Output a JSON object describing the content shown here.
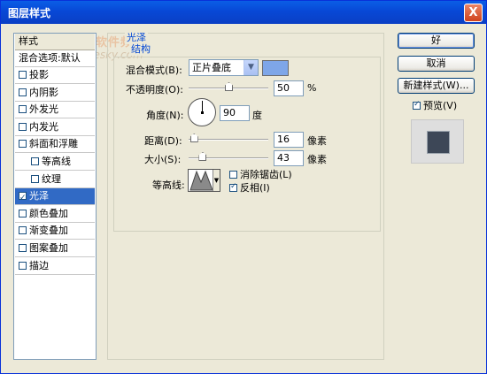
{
  "window": {
    "title": "图层样式",
    "close_label": "X"
  },
  "styles_list": {
    "header": "样式",
    "blend_default": "混合选项:默认",
    "items": [
      {
        "label": "投影",
        "checked": false,
        "indent": 0
      },
      {
        "label": "内阴影",
        "checked": false,
        "indent": 0
      },
      {
        "label": "外发光",
        "checked": false,
        "indent": 0
      },
      {
        "label": "内发光",
        "checked": false,
        "indent": 0
      },
      {
        "label": "斜面和浮雕",
        "checked": false,
        "indent": 0
      },
      {
        "label": "等高线",
        "checked": false,
        "indent": 1
      },
      {
        "label": "纹理",
        "checked": false,
        "indent": 1
      },
      {
        "label": "光泽",
        "checked": true,
        "indent": 0,
        "selected": true
      },
      {
        "label": "颜色叠加",
        "checked": false,
        "indent": 0
      },
      {
        "label": "渐变叠加",
        "checked": false,
        "indent": 0
      },
      {
        "label": "图案叠加",
        "checked": false,
        "indent": 0
      },
      {
        "label": "描边",
        "checked": false,
        "indent": 0
      }
    ]
  },
  "panel": {
    "section_title": "光泽",
    "group_title": "结构",
    "blend_mode_label": "混合模式(B):",
    "blend_mode_value": "正片叠底",
    "blend_color": "#7ea6e8",
    "opacity_label": "不透明度(O):",
    "opacity_value": "50",
    "opacity_unit": "%",
    "angle_label": "角度(N):",
    "angle_value": "90",
    "angle_unit": "度",
    "distance_label": "距离(D):",
    "distance_value": "16",
    "distance_unit": "像素",
    "size_label": "大小(S):",
    "size_value": "43",
    "size_unit": "像素",
    "contour_label": "等高线:",
    "antialias_label": "消除锯齿(L)",
    "antialias_checked": false,
    "invert_label": "反相(I)",
    "invert_checked": true
  },
  "buttons": {
    "ok": "好",
    "cancel": "取消",
    "new_style": "新建样式(W)...",
    "preview_label": "预览(V)",
    "preview_checked": true
  },
  "watermark": {
    "line1": "天极软件频道",
    "line2": "soft.yesky.com"
  }
}
